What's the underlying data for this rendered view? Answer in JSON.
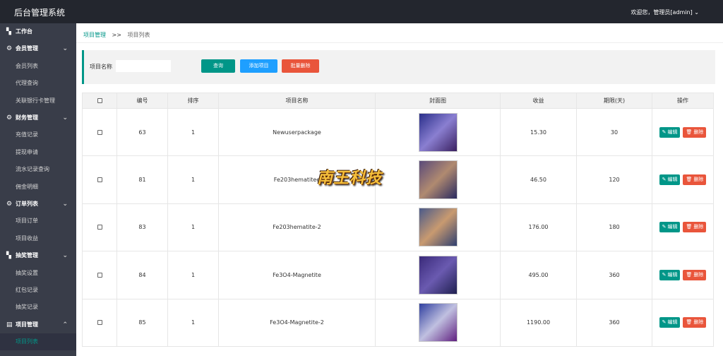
{
  "header": {
    "app_title": "后台管理系统",
    "user_text": "欢迎您，管理员[admin]",
    "caret": "⌄"
  },
  "sidebar": {
    "items": [
      {
        "type": "group",
        "icon": "dashboard-icon",
        "icon_glyph": "▚",
        "label": "工作台",
        "chevron": ""
      },
      {
        "type": "group",
        "icon": "gear-icon",
        "icon_glyph": "⚙",
        "label": "会员管理",
        "chevron": "⌄"
      },
      {
        "type": "sub",
        "label": "会员列表"
      },
      {
        "type": "sub",
        "label": "代理查询"
      },
      {
        "type": "sub",
        "label": "关联银行卡管理"
      },
      {
        "type": "group",
        "icon": "gear-icon",
        "icon_glyph": "⚙",
        "label": "财务管理",
        "chevron": "⌄"
      },
      {
        "type": "sub",
        "label": "充值记录"
      },
      {
        "type": "sub",
        "label": "提现申请"
      },
      {
        "type": "sub",
        "label": "流水记录查询"
      },
      {
        "type": "sub",
        "label": "佣金明细"
      },
      {
        "type": "group",
        "icon": "gear-icon",
        "icon_glyph": "⚙",
        "label": "订单列表",
        "chevron": "⌄"
      },
      {
        "type": "sub",
        "label": "项目订单"
      },
      {
        "type": "sub",
        "label": "项目收益"
      },
      {
        "type": "group",
        "icon": "grid-icon",
        "icon_glyph": "▚",
        "label": "抽奖管理",
        "chevron": "⌄"
      },
      {
        "type": "sub",
        "label": "抽奖设置"
      },
      {
        "type": "sub",
        "label": "红包记录"
      },
      {
        "type": "sub",
        "label": "抽奖记录"
      },
      {
        "type": "group",
        "icon": "list-icon",
        "icon_glyph": "▤",
        "label": "项目管理",
        "chevron": "⌃"
      },
      {
        "type": "sub",
        "label": "项目列表",
        "active": true
      }
    ]
  },
  "breadcrumb": {
    "parent": "项目管理",
    "separator": ">>",
    "current": "项目列表"
  },
  "search": {
    "label": "项目名称",
    "value": "",
    "placeholder": "",
    "query_label": "查询",
    "add_label": "添加项目",
    "batch_delete_label": "批量删除"
  },
  "table": {
    "headers": [
      "",
      "编号",
      "排序",
      "项目名称",
      "封面图",
      "收益",
      "期限(天)",
      "操作"
    ],
    "rows": [
      {
        "id": "63",
        "sort": "1",
        "name": "Newuserpackage",
        "income": "15.30",
        "days": "30",
        "cover_colors": [
          "#2a2f8a",
          "#8a7fd1",
          "#3a2060"
        ]
      },
      {
        "id": "81",
        "sort": "1",
        "name": "Fe203hematitee",
        "income": "46.50",
        "days": "120",
        "cover_colors": [
          "#5a4a7a",
          "#b08a70",
          "#2a2a60"
        ]
      },
      {
        "id": "83",
        "sort": "1",
        "name": "Fe203hematite-2",
        "income": "176.00",
        "days": "180",
        "cover_colors": [
          "#4a5a8a",
          "#c89a70",
          "#304070"
        ]
      },
      {
        "id": "84",
        "sort": "1",
        "name": "Fe3O4-Magnetite",
        "income": "495.00",
        "days": "360",
        "cover_colors": [
          "#3a2a7a",
          "#6a5ab0",
          "#202050"
        ]
      },
      {
        "id": "85",
        "sort": "1",
        "name": "Fe3O4-Magnetite-2",
        "income": "1190.00",
        "days": "360",
        "cover_colors": [
          "#3040a0",
          "#c0c0e0",
          "#602080"
        ]
      }
    ],
    "edit_label": "编辑",
    "delete_label": "删除",
    "edit_icon": "✎",
    "delete_icon": "🗑"
  },
  "watermark": {
    "text": "南王科技"
  },
  "colors": {
    "accent": "#009688",
    "blue": "#1e9fff",
    "danger": "#e9553b",
    "sidebar_bg": "#393d49",
    "topbar_bg": "#23262e"
  }
}
